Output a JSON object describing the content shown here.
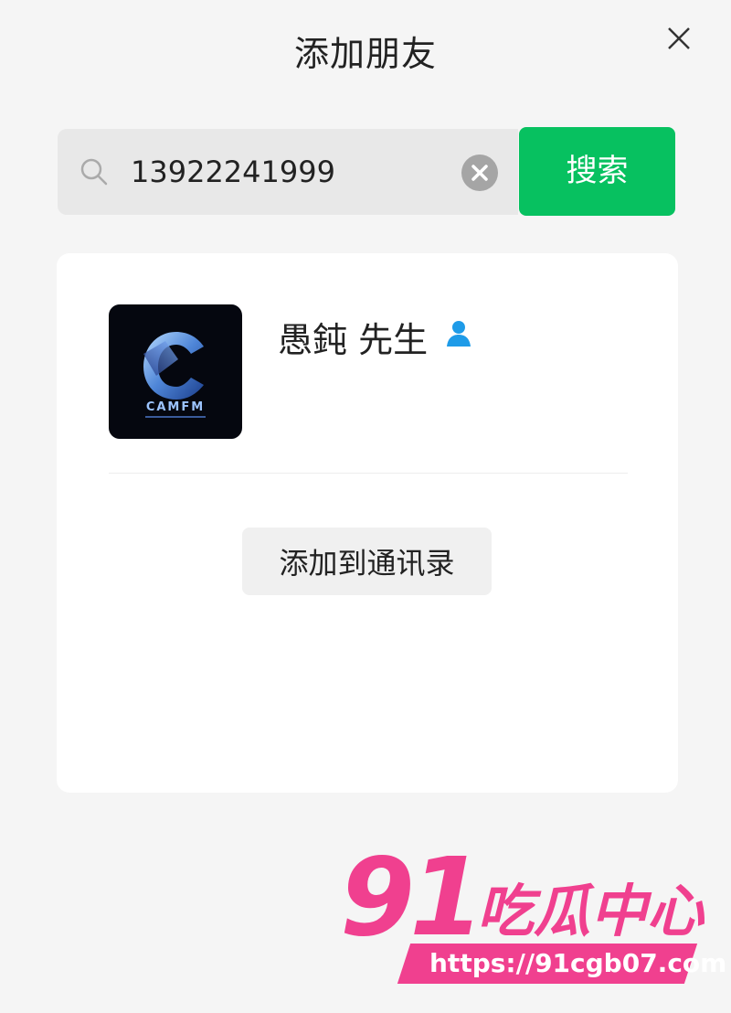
{
  "window": {
    "title": "添加朋友"
  },
  "search": {
    "value": "13922241999",
    "button_label": "搜索"
  },
  "result": {
    "name": "愚鈍 先生",
    "avatar_text": "CAMFM",
    "add_button_label": "添加到通讯录"
  },
  "watermark": {
    "number": "91",
    "text": "吃瓜中心",
    "url": "https://91cgb07.com"
  },
  "colors": {
    "accent": "#07c160",
    "background": "#f5f5f5",
    "card": "#ffffff",
    "watermark": "#f0408f",
    "gender_icon": "#1e9be8"
  },
  "icons": {
    "close": "close-icon",
    "search": "search-icon",
    "clear": "clear-icon",
    "gender": "male-icon"
  }
}
